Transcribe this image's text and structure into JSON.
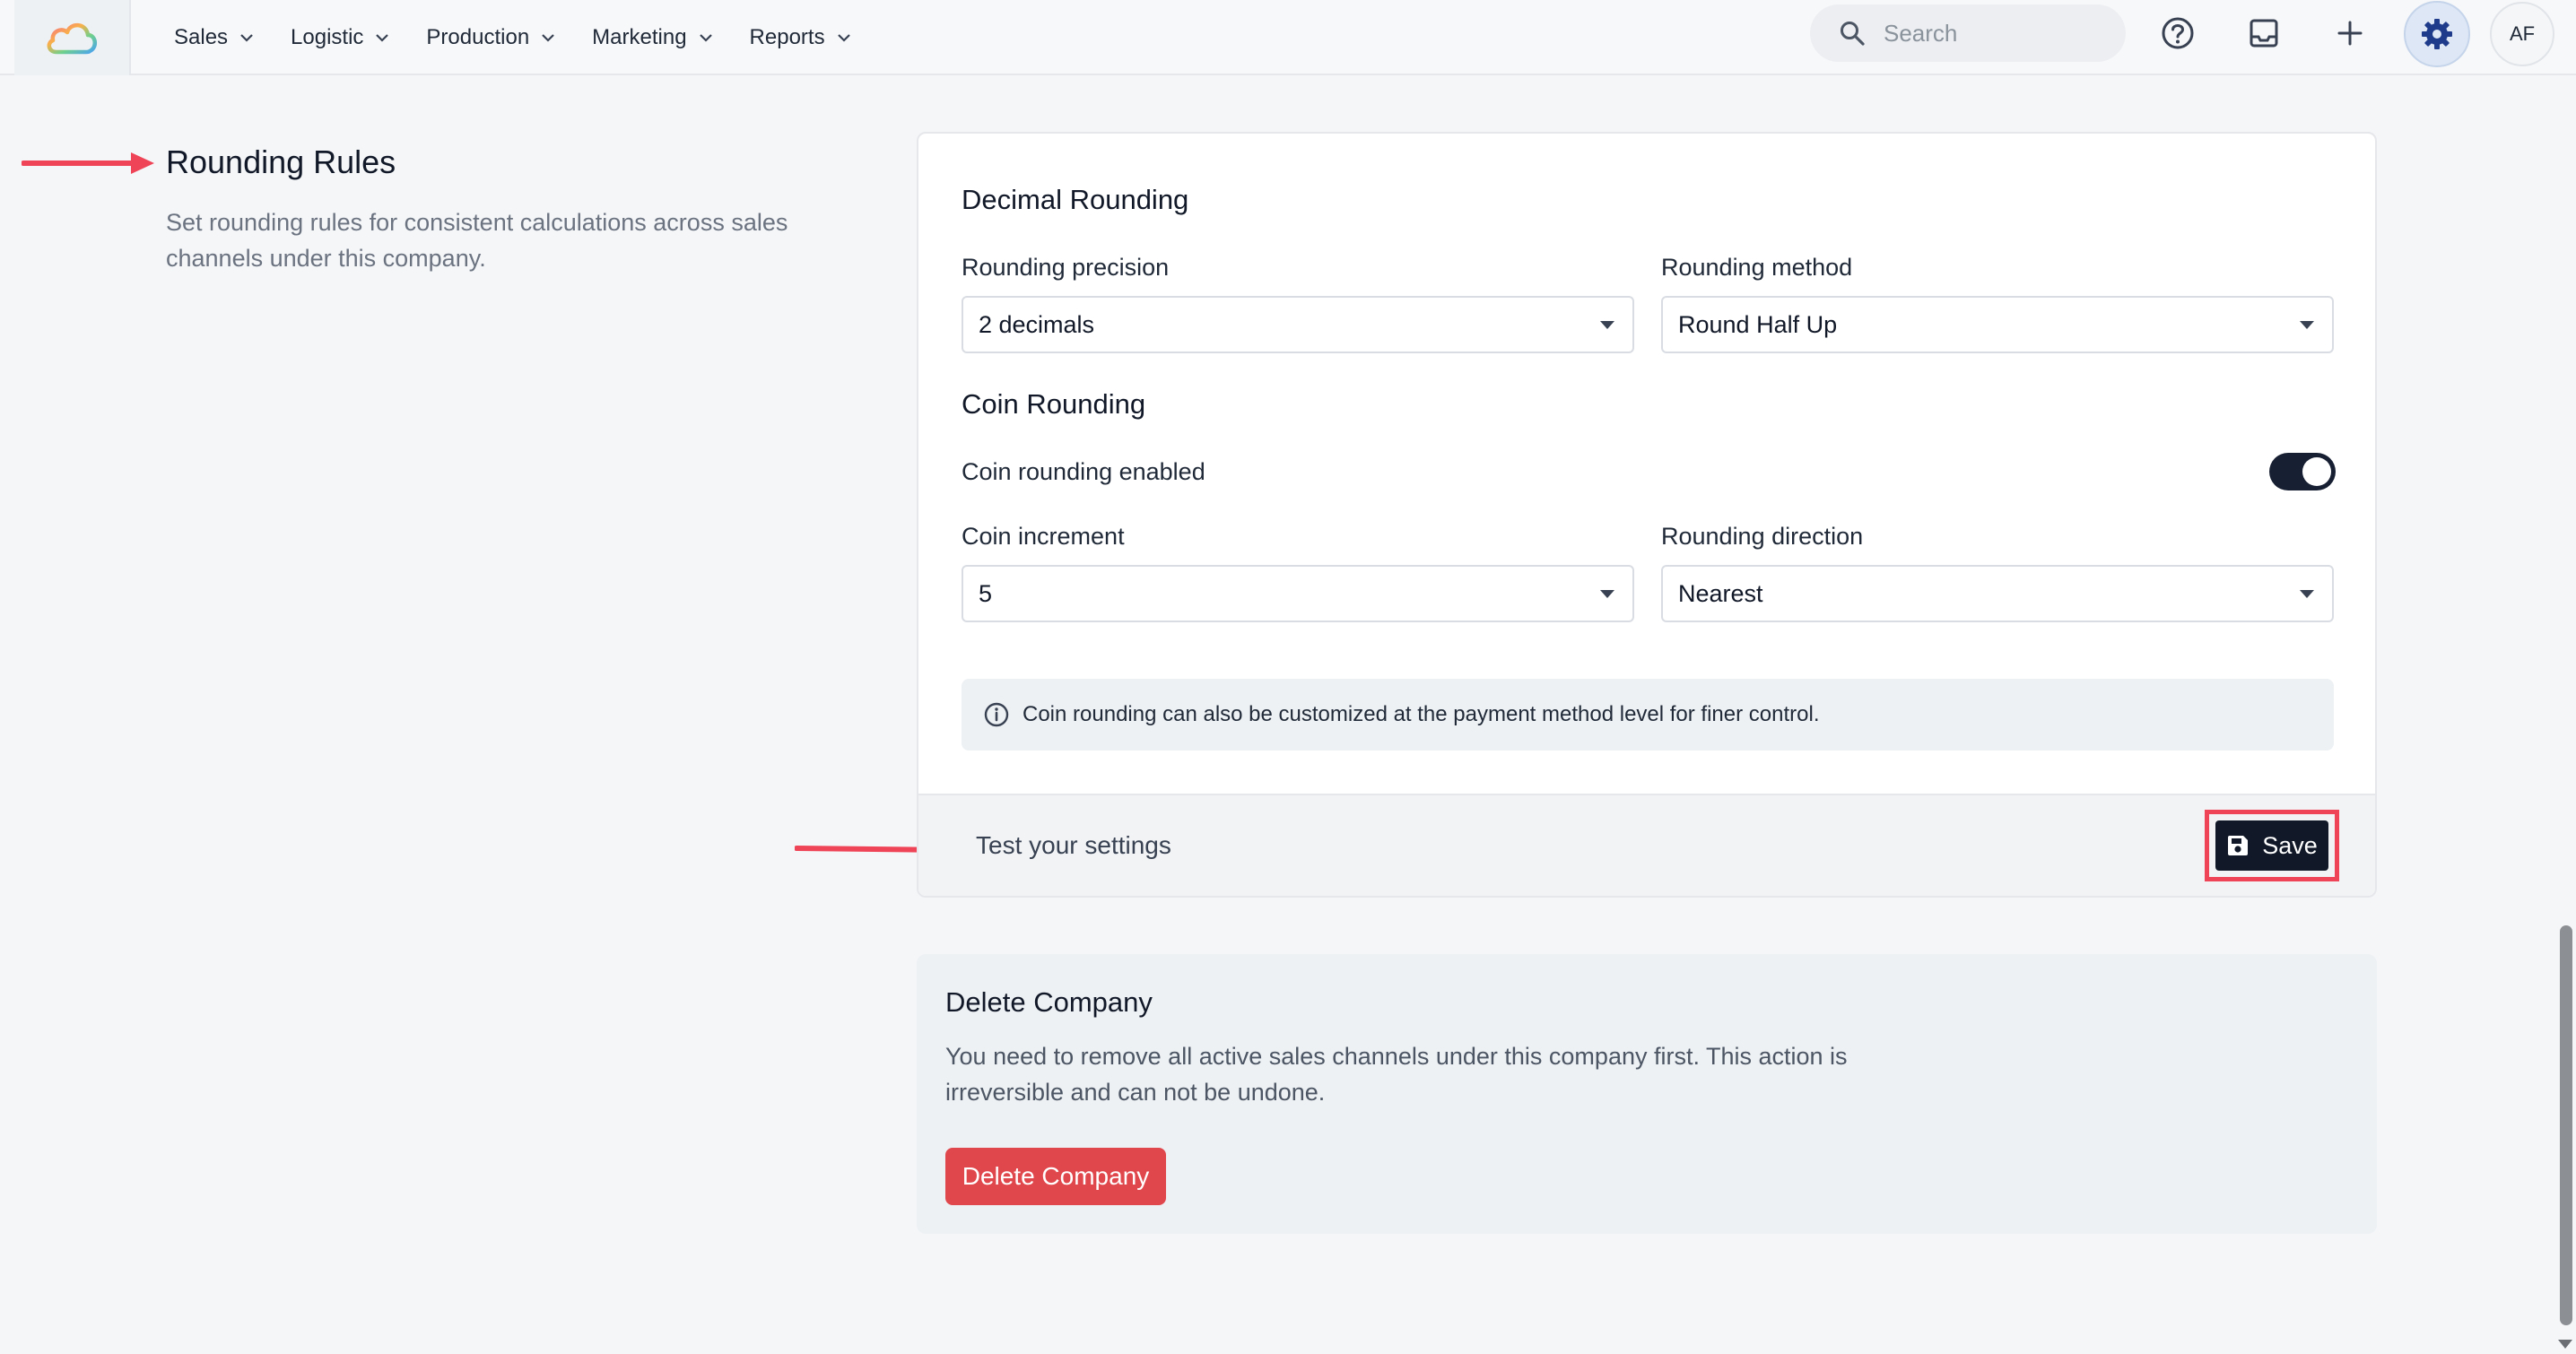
{
  "nav": {
    "items": [
      {
        "label": "Sales"
      },
      {
        "label": "Logistic"
      },
      {
        "label": "Production"
      },
      {
        "label": "Marketing"
      },
      {
        "label": "Reports"
      }
    ],
    "search_placeholder": "Search",
    "avatar_initials": "AF",
    "icons": [
      "cloud-logo-icon",
      "search-icon",
      "help-icon",
      "inbox-icon",
      "plus-icon",
      "gear-icon"
    ]
  },
  "rounding_section": {
    "title": "Rounding Rules",
    "description": "Set rounding rules for consistent calculations across sales channels under this company."
  },
  "decimal_rounding": {
    "heading": "Decimal Rounding",
    "precision_label": "Rounding precision",
    "precision_value": "2 decimals",
    "method_label": "Rounding method",
    "method_value": "Round Half Up"
  },
  "coin_rounding": {
    "heading": "Coin Rounding",
    "enabled_label": "Coin rounding enabled",
    "enabled": true,
    "increment_label": "Coin increment",
    "increment_value": "5",
    "direction_label": "Rounding direction",
    "direction_value": "Nearest"
  },
  "info_note": "Coin rounding can also be customized at the payment method level for finer control.",
  "footer": {
    "text": "Test your settings",
    "save_label": "Save"
  },
  "delete_section": {
    "title": "Delete Company",
    "description": "You need to remove all active sales channels under this company first. This action is irreversible and can not be undone.",
    "button_label": "Delete Company"
  },
  "colors": {
    "accent_annotation": "#ef4457",
    "primary_dark": "#111827",
    "danger": "#e0474c"
  }
}
